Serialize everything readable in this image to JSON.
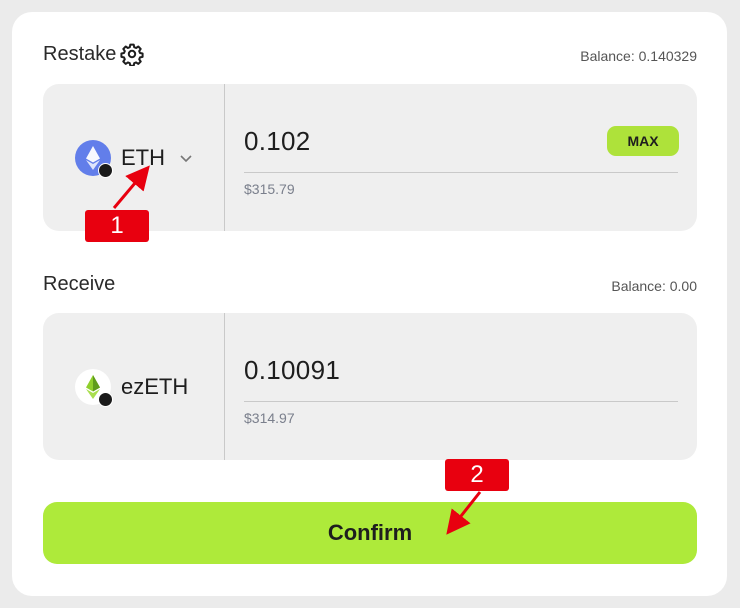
{
  "restake": {
    "title": "Restake",
    "balance": "Balance: 0.140329",
    "token": "ETH",
    "amount": "0.102",
    "usd": "$315.79",
    "max_label": "MAX"
  },
  "receive": {
    "title": "Receive",
    "balance": "Balance: 0.00",
    "token": "ezETH",
    "amount": "0.10091",
    "usd": "$314.97"
  },
  "confirm_label": "Confirm",
  "annotations": [
    "1",
    "2"
  ],
  "icons": {
    "settings": "gear-icon",
    "eth": "eth-token-icon",
    "ezeth": "ezeth-token-icon",
    "dropdown": "chevron-down-icon"
  },
  "colors": {
    "accent": "#aeea3a",
    "annotation": "#e8000f",
    "eth_blue": "#627eea"
  }
}
